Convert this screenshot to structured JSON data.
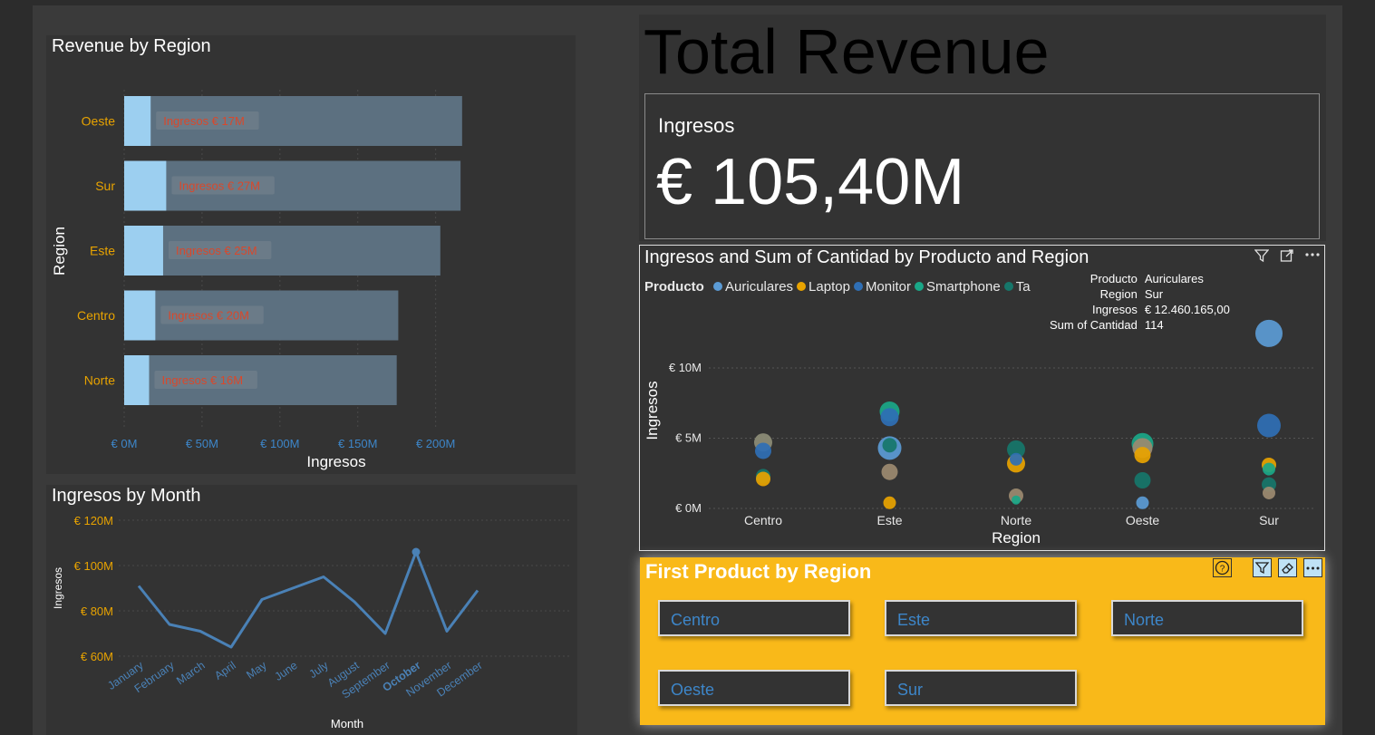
{
  "colors": {
    "accent_orange": "#e8a300",
    "bar_fill": "#5c7080",
    "bar_highlight": "#9ccff0",
    "line_blue": "#4a81b6",
    "data_label_red": "#d9482b",
    "slicer_yellow": "#f9b919"
  },
  "header": {
    "title": "Total Revenue"
  },
  "kpi_card": {
    "label": "Ingresos",
    "value": "€ 105,40M"
  },
  "revenue_by_region": {
    "title": "Revenue by Region"
  },
  "ingresos_by_month": {
    "title": "Ingresos by Month"
  },
  "scatter": {
    "title": "Ingresos and Sum of Cantidad by Producto and Region",
    "icons": [
      "filter-icon",
      "focus-mode-icon",
      "more-options-icon"
    ],
    "legend_title": "Producto",
    "legend": [
      {
        "name": "Auriculares",
        "color": "#5b9bd5"
      },
      {
        "name": "Laptop",
        "color": "#e8a300"
      },
      {
        "name": "Monitor",
        "color": "#2f6fb5"
      },
      {
        "name": "Smartphone",
        "color": "#1aa788"
      },
      {
        "name": "Ta",
        "color": "#16766a"
      }
    ],
    "tooltip": {
      "rows": [
        {
          "k": "Producto",
          "v": "Auriculares"
        },
        {
          "k": "Region",
          "v": "Sur"
        },
        {
          "k": "Ingresos",
          "v": "€ 12.460.165,00"
        },
        {
          "k": "Sum of Cantidad",
          "v": "114"
        }
      ]
    }
  },
  "slicer": {
    "title": "First Product by Region",
    "icons": [
      "help-icon",
      "filter-icon",
      "eraser-icon",
      "more-options-icon"
    ],
    "items": [
      "Centro",
      "Este",
      "Norte",
      "Oeste",
      "Sur"
    ]
  },
  "chart_data": [
    {
      "type": "bar",
      "orientation": "horizontal",
      "title": "Revenue by Region",
      "categories": [
        "Oeste",
        "Sur",
        "Este",
        "Centro",
        "Norte"
      ],
      "values": [
        217,
        216,
        203,
        176,
        175
      ],
      "highlight_values": [
        17,
        27,
        25,
        20,
        16
      ],
      "data_labels": [
        "Ingresos € 17M",
        "Ingresos € 27M",
        "Ingresos € 25M",
        "Ingresos € 20M",
        "Ingresos € 16M"
      ],
      "xlabel": "Ingresos",
      "ylabel": "Region",
      "xlim": [
        0,
        220
      ],
      "ticks": [
        "€ 0M",
        "€ 50M",
        "€ 100M",
        "€ 150M",
        "€ 200M"
      ],
      "tick_values": [
        0,
        50,
        100,
        150,
        200
      ],
      "grid": true
    },
    {
      "type": "line",
      "title": "Ingresos by Month",
      "categories": [
        "January",
        "February",
        "March",
        "April",
        "May",
        "June",
        "July",
        "August",
        "September",
        "October",
        "November",
        "December"
      ],
      "values": [
        91,
        74,
        71,
        64,
        85,
        90,
        95,
        84,
        70,
        106,
        71,
        89
      ],
      "xlabel": "Month",
      "ylabel": "Ingresos",
      "ylim": [
        60,
        122
      ],
      "ticks": [
        "€ 60M",
        "€ 80M",
        "€ 100M",
        "€ 120M"
      ],
      "tick_values": [
        60,
        80,
        100,
        120
      ],
      "highlighted_category": "October",
      "grid": true
    },
    {
      "type": "scatter",
      "title": "Ingresos and Sum of Cantidad by Producto and Region",
      "categories": [
        "Centro",
        "Este",
        "Norte",
        "Oeste",
        "Sur"
      ],
      "xlabel": "Region",
      "ylabel": "Ingresos",
      "ylim": [
        0,
        13
      ],
      "ticks": [
        "€ 0M",
        "€ 5M",
        "€ 10M"
      ],
      "tick_values": [
        0,
        5,
        10
      ],
      "points": [
        {
          "category": "Centro",
          "y": 4.7,
          "size": 10,
          "color": "#8d8d77"
        },
        {
          "category": "Centro",
          "y": 4.1,
          "size": 9,
          "color": "#2f6fb5"
        },
        {
          "category": "Centro",
          "y": 2.3,
          "size": 8,
          "color": "#16766a"
        },
        {
          "category": "Centro",
          "y": 2.1,
          "size": 8,
          "color": "#e8a300"
        },
        {
          "category": "Este",
          "y": 6.9,
          "size": 11,
          "color": "#1aa788"
        },
        {
          "category": "Este",
          "y": 6.5,
          "size": 10,
          "color": "#2f6fb5"
        },
        {
          "category": "Este",
          "y": 4.3,
          "size": 13,
          "color": "#5b9bd5"
        },
        {
          "category": "Este",
          "y": 4.5,
          "size": 8,
          "color": "#16766a"
        },
        {
          "category": "Este",
          "y": 2.6,
          "size": 9,
          "color": "#9c8a70"
        },
        {
          "category": "Este",
          "y": 0.4,
          "size": 7,
          "color": "#e8a300"
        },
        {
          "category": "Norte",
          "y": 4.2,
          "size": 10,
          "color": "#16766a"
        },
        {
          "category": "Norte",
          "y": 3.2,
          "size": 10,
          "color": "#e8a300"
        },
        {
          "category": "Norte",
          "y": 3.5,
          "size": 7,
          "color": "#2f6fb5"
        },
        {
          "category": "Norte",
          "y": 0.9,
          "size": 8,
          "color": "#9c8a70"
        },
        {
          "category": "Norte",
          "y": 0.6,
          "size": 5,
          "color": "#1aa788"
        },
        {
          "category": "Oeste",
          "y": 4.6,
          "size": 12,
          "color": "#1aa788"
        },
        {
          "category": "Oeste",
          "y": 4.3,
          "size": 11,
          "color": "#9c8a70"
        },
        {
          "category": "Oeste",
          "y": 3.8,
          "size": 9,
          "color": "#e8a300"
        },
        {
          "category": "Oeste",
          "y": 2.0,
          "size": 9,
          "color": "#16766a"
        },
        {
          "category": "Oeste",
          "y": 0.4,
          "size": 7,
          "color": "#5b9bd5"
        },
        {
          "category": "Sur",
          "y": 12.46,
          "size": 15,
          "color": "#5b9bd5"
        },
        {
          "category": "Sur",
          "y": 5.9,
          "size": 13,
          "color": "#2f6fb5"
        },
        {
          "category": "Sur",
          "y": 3.1,
          "size": 8,
          "color": "#e8a300"
        },
        {
          "category": "Sur",
          "y": 2.8,
          "size": 7,
          "color": "#1aa788"
        },
        {
          "category": "Sur",
          "y": 1.7,
          "size": 8,
          "color": "#16766a"
        },
        {
          "category": "Sur",
          "y": 1.1,
          "size": 7,
          "color": "#9c8a70"
        }
      ]
    }
  ]
}
